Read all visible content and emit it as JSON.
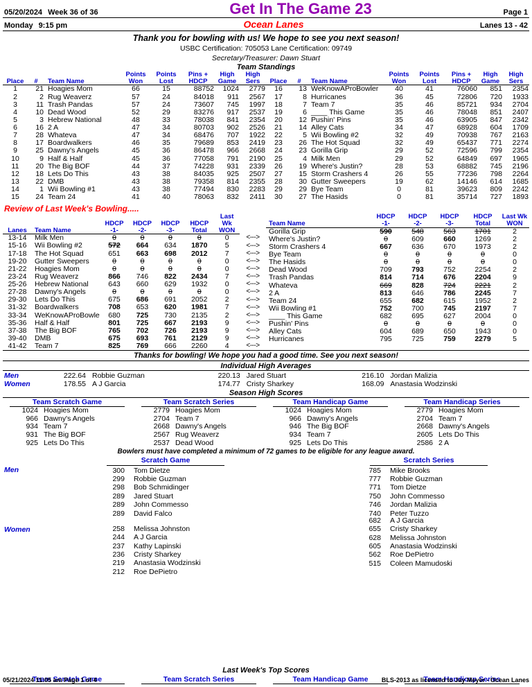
{
  "header": {
    "date": "05/20/2024",
    "week": "Week 36 of 36",
    "title": "Get In The Game 23",
    "page": "Page 1",
    "day": "Monday",
    "time": "9:15 pm",
    "center": "Ocean Lanes",
    "lanes": "Lanes 13 - 42",
    "thanks": "Thank you for bowling with us! We hope to see you next season!",
    "certification": "USBC Certification: 705053   Lane Certification: 09749",
    "secretary": "Secretary/Treasurer: Dawn Stuart"
  },
  "standings": {
    "section_title": "Team Standings",
    "columns": [
      "Place",
      "#",
      "Team Name",
      "Points Won",
      "Points Lost",
      "Pins + HDCP",
      "High Game",
      "High Sers"
    ],
    "headers": {
      "place": "Place",
      "num": "#",
      "team": "Team Name",
      "pts_won_1": "Points",
      "pts_won_2": "Won",
      "pts_lost_1": "Points",
      "pts_lost_2": "Lost",
      "pins_1": "Pins +",
      "pins_2": "HDCP",
      "hg_1": "High",
      "hg_2": "Game",
      "hs_1": "High",
      "hs_2": "Sers"
    },
    "left": [
      {
        "place": "1",
        "num": "21",
        "team": "Hoagies Mom",
        "won": "66",
        "lost": "15",
        "pins": "88752",
        "hg": "1024",
        "hs": "2779"
      },
      {
        "place": "2",
        "num": "2",
        "team": "Rug Weaverz",
        "won": "57",
        "lost": "24",
        "pins": "84018",
        "hg": "911",
        "hs": "2567"
      },
      {
        "place": "3",
        "num": "11",
        "team": "Trash Pandas",
        "won": "57",
        "lost": "24",
        "pins": "73607",
        "hg": "745",
        "hs": "1997"
      },
      {
        "place": "4",
        "num": "10",
        "team": "Dead Wood",
        "won": "52",
        "lost": "29",
        "pins": "83276",
        "hg": "917",
        "hs": "2537"
      },
      {
        "place": "5",
        "num": "3",
        "team": "Hebrew National",
        "won": "48",
        "lost": "33",
        "pins": "78038",
        "hg": "841",
        "hs": "2354"
      },
      {
        "place": "6",
        "num": "16",
        "team": "2 A",
        "won": "47",
        "lost": "34",
        "pins": "80703",
        "hg": "902",
        "hs": "2526"
      },
      {
        "place": "7",
        "num": "28",
        "team": "Whateva",
        "won": "47",
        "lost": "34",
        "pins": "68476",
        "hg": "707",
        "hs": "1922"
      },
      {
        "place": "8",
        "num": "17",
        "team": "Boardwalkers",
        "won": "46",
        "lost": "35",
        "pins": "79689",
        "hg": "853",
        "hs": "2419"
      },
      {
        "place": "9",
        "num": "25",
        "team": "Dawny's Angels",
        "won": "45",
        "lost": "36",
        "pins": "86478",
        "hg": "966",
        "hs": "2668"
      },
      {
        "place": "10",
        "num": "9",
        "team": "Half & Half",
        "won": "45",
        "lost": "36",
        "pins": "77058",
        "hg": "791",
        "hs": "2190"
      },
      {
        "place": "11",
        "num": "20",
        "team": "The Big BOF",
        "won": "44",
        "lost": "37",
        "pins": "74228",
        "hg": "931",
        "hs": "2339"
      },
      {
        "place": "12",
        "num": "18",
        "team": "Lets Do This",
        "won": "43",
        "lost": "38",
        "pins": "84035",
        "hg": "925",
        "hs": "2507"
      },
      {
        "place": "13",
        "num": "22",
        "team": "DMB",
        "won": "43",
        "lost": "38",
        "pins": "79358",
        "hg": "814",
        "hs": "2355"
      },
      {
        "place": "14",
        "num": "1",
        "team": "Wii Bowling #1",
        "won": "43",
        "lost": "38",
        "pins": "77494",
        "hg": "830",
        "hs": "2283"
      },
      {
        "place": "15",
        "num": "24",
        "team": "Team 24",
        "won": "41",
        "lost": "40",
        "pins": "78063",
        "hg": "832",
        "hs": "2411"
      }
    ],
    "right": [
      {
        "place": "16",
        "num": "13",
        "team": "WeKnowAProBowler",
        "won": "40",
        "lost": "41",
        "pins": "76060",
        "hg": "851",
        "hs": "2354"
      },
      {
        "place": "17",
        "num": "8",
        "team": "Hurricanes",
        "won": "36",
        "lost": "45",
        "pins": "72806",
        "hg": "720",
        "hs": "1933"
      },
      {
        "place": "18",
        "num": "7",
        "team": "Team 7",
        "won": "35",
        "lost": "46",
        "pins": "85721",
        "hg": "934",
        "hs": "2704"
      },
      {
        "place": "19",
        "num": "6",
        "team": "____ This Game",
        "won": "35",
        "lost": "46",
        "pins": "78048",
        "hg": "851",
        "hs": "2407"
      },
      {
        "place": "20",
        "num": "12",
        "team": "Pushin' Pins",
        "won": "35",
        "lost": "46",
        "pins": "63905",
        "hg": "847",
        "hs": "2342"
      },
      {
        "place": "21",
        "num": "14",
        "team": "Alley Cats",
        "won": "34",
        "lost": "47",
        "pins": "68928",
        "hg": "604",
        "hs": "1709"
      },
      {
        "place": "22",
        "num": "5",
        "team": "Wii Bowling #2",
        "won": "32",
        "lost": "49",
        "pins": "70938",
        "hg": "767",
        "hs": "2163"
      },
      {
        "place": "23",
        "num": "26",
        "team": "The Hot Squad",
        "won": "32",
        "lost": "49",
        "pins": "65437",
        "hg": "771",
        "hs": "2274"
      },
      {
        "place": "24",
        "num": "23",
        "team": "Gorilla Grip",
        "won": "29",
        "lost": "52",
        "pins": "72596",
        "hg": "799",
        "hs": "2354"
      },
      {
        "place": "25",
        "num": "4",
        "team": "Milk Men",
        "won": "29",
        "lost": "52",
        "pins": "64849",
        "hg": "697",
        "hs": "1965"
      },
      {
        "place": "26",
        "num": "19",
        "team": "Where's Justin?",
        "won": "28",
        "lost": "53",
        "pins": "68882",
        "hg": "745",
        "hs": "2196"
      },
      {
        "place": "27",
        "num": "15",
        "team": "Storm Crashers 4",
        "won": "26",
        "lost": "55",
        "pins": "77236",
        "hg": "798",
        "hs": "2264"
      },
      {
        "place": "28",
        "num": "30",
        "team": "Gutter Sweepers",
        "won": "19",
        "lost": "62",
        "pins": "14146",
        "hg": "614",
        "hs": "1685"
      },
      {
        "place": "29",
        "num": "29",
        "team": "Bye Team",
        "won": "0",
        "lost": "81",
        "pins": "39623",
        "hg": "809",
        "hs": "2242"
      },
      {
        "place": "30",
        "num": "27",
        "team": "The Hasids",
        "won": "0",
        "lost": "81",
        "pins": "35714",
        "hg": "727",
        "hs": "1893"
      }
    ]
  },
  "review": {
    "title": "Review of Last Week's Bowling.....",
    "headers": {
      "lanes": "Lanes",
      "team": "Team Name",
      "h1_1": "HDCP",
      "h1_2": "-1-",
      "h2_1": "HDCP",
      "h2_2": "-2-",
      "h3_1": "HDCP",
      "h3_2": "-3-",
      "tot_1": "HDCP",
      "tot_2": "Total",
      "won_1": "Last Wk",
      "won_2": "WON"
    },
    "arrow": "<--->",
    "left": [
      {
        "lanes": "13-14",
        "team": "Milk Men",
        "g1": "0",
        "g1s": true,
        "g2": "0",
        "g2s": true,
        "g3": "0",
        "g3s": true,
        "tot": "0",
        "tots": true,
        "won": "0"
      },
      {
        "lanes": "15-16",
        "team": "Wii Bowling #2",
        "g1": "572",
        "g1s": true,
        "g1b": true,
        "g2": "664",
        "g2b": true,
        "g3": "634",
        "tot": "1870",
        "totb": true,
        "won": "5"
      },
      {
        "lanes": "17-18",
        "team": "The Hot Squad",
        "g1": "651",
        "g2": "663",
        "g2b": true,
        "g3": "698",
        "g3b": true,
        "tot": "2012",
        "totb": true,
        "won": "7"
      },
      {
        "lanes": "19-20",
        "team": "Gutter Sweepers",
        "g1": "0",
        "g1s": true,
        "g2": "0",
        "g2s": true,
        "g3": "0",
        "g3s": true,
        "tot": "0",
        "tots": true,
        "won": "0"
      },
      {
        "lanes": "21-22",
        "team": "Hoagies Mom",
        "g1": "0",
        "g1s": true,
        "g2": "0",
        "g2s": true,
        "g3": "0",
        "g3s": true,
        "tot": "0",
        "tots": true,
        "won": "0"
      },
      {
        "lanes": "23-24",
        "team": "Rug Weaverz",
        "g1": "866",
        "g1b": true,
        "g2": "746",
        "g3": "822",
        "g3b": true,
        "tot": "2434",
        "totb": true,
        "won": "7"
      },
      {
        "lanes": "25-26",
        "team": "Hebrew National",
        "g1": "643",
        "g2": "660",
        "g3": "629",
        "tot": "1932",
        "won": "0"
      },
      {
        "lanes": "27-28",
        "team": "Dawny's Angels",
        "g1": "0",
        "g1s": true,
        "g2": "0",
        "g2s": true,
        "g3": "0",
        "g3s": true,
        "tot": "0",
        "tots": true,
        "won": "0"
      },
      {
        "lanes": "29-30",
        "team": "Lets Do This",
        "g1": "675",
        "g2": "686",
        "g2b": true,
        "g3": "691",
        "tot": "2052",
        "won": "2"
      },
      {
        "lanes": "31-32",
        "team": "Boardwalkers",
        "g1": "708",
        "g1b": true,
        "g2": "653",
        "g3": "620",
        "g3b": true,
        "tot": "1981",
        "totb": true,
        "won": "7"
      },
      {
        "lanes": "33-34",
        "team": "WeKnowAProBowle",
        "g1": "680",
        "g2": "725",
        "g2b": true,
        "g3": "730",
        "tot": "2135",
        "won": "2"
      },
      {
        "lanes": "35-36",
        "team": "Half & Half",
        "g1": "801",
        "g1b": true,
        "g2": "725",
        "g2b": true,
        "g3": "667",
        "g3b": true,
        "tot": "2193",
        "totb": true,
        "won": "9"
      },
      {
        "lanes": "37-38",
        "team": "The Big BOF",
        "g1": "765",
        "g1b": true,
        "g2": "702",
        "g2b": true,
        "g3": "726",
        "g3b": true,
        "tot": "2193",
        "totb": true,
        "won": "9"
      },
      {
        "lanes": "39-40",
        "team": "DMB",
        "g1": "675",
        "g1b": true,
        "g2": "693",
        "g2b": true,
        "g3": "761",
        "g3b": true,
        "tot": "2129",
        "totb": true,
        "won": "9"
      },
      {
        "lanes": "41-42",
        "team": "Team 7",
        "g1": "825",
        "g1b": true,
        "g2": "769",
        "g2b": true,
        "g3": "666",
        "tot": "2260",
        "won": "4"
      }
    ],
    "right": [
      {
        "team": "Gorilla Grip",
        "g1": "590",
        "g1b": true,
        "g1s": true,
        "g2": "548",
        "g2s": true,
        "g3": "563",
        "g3s": true,
        "tot": "1701",
        "tots": true,
        "won": "2"
      },
      {
        "team": "Where's Justin?",
        "g1": "0",
        "g1s": true,
        "g2": "609",
        "g3": "660",
        "g3b": true,
        "tot": "1269",
        "won": "2"
      },
      {
        "team": "Storm Crashers 4",
        "g1": "667",
        "g1b": true,
        "g2": "636",
        "g3": "670",
        "tot": "1973",
        "won": "2"
      },
      {
        "team": "Bye Team",
        "g1": "0",
        "g1s": true,
        "g2": "0",
        "g2s": true,
        "g3": "0",
        "g3s": true,
        "tot": "0",
        "tots": true,
        "won": "0"
      },
      {
        "team": "The Hasids",
        "g1": "0",
        "g1s": true,
        "g2": "0",
        "g2s": true,
        "g3": "0",
        "g3s": true,
        "tot": "0",
        "tots": true,
        "won": "0"
      },
      {
        "team": "Dead Wood",
        "g1": "709",
        "g2": "793",
        "g2b": true,
        "g3": "752",
        "tot": "2254",
        "won": "2"
      },
      {
        "team": "Trash Pandas",
        "g1": "814",
        "g1b": true,
        "g2": "714",
        "g2b": true,
        "g3": "676",
        "g3b": true,
        "tot": "2204",
        "totb": true,
        "won": "9"
      },
      {
        "team": "Whateva",
        "g1": "669",
        "g1s": true,
        "g2": "828",
        "g2b": true,
        "g3": "724",
        "g3s": true,
        "tot": "2221",
        "tots": true,
        "won": "2"
      },
      {
        "team": "2 A",
        "g1": "813",
        "g1b": true,
        "g2": "646",
        "g3": "786",
        "g3b": true,
        "tot": "2245",
        "totb": true,
        "won": "7"
      },
      {
        "team": "Team 24",
        "g1": "655",
        "g2": "682",
        "g2b": true,
        "g3": "615",
        "tot": "1952",
        "won": "2"
      },
      {
        "team": "Wii Bowling #1",
        "g1": "752",
        "g1b": true,
        "g2": "700",
        "g3": "745",
        "g3b": true,
        "tot": "2197",
        "totb": true,
        "won": "7"
      },
      {
        "team": "____ This Game",
        "g1": "682",
        "g2": "695",
        "g3": "627",
        "tot": "2004",
        "won": "0"
      },
      {
        "team": "Pushin' Pins",
        "g1": "0",
        "g1s": true,
        "g2": "0",
        "g2s": true,
        "g3": "0",
        "g3s": true,
        "tot": "0",
        "tots": true,
        "won": "0"
      },
      {
        "team": "Alley Cats",
        "g1": "604",
        "g2": "689",
        "g3": "650",
        "tot": "1943",
        "won": "0"
      },
      {
        "team": "Hurricanes",
        "g1": "795",
        "g2": "725",
        "g3": "759",
        "g3b": true,
        "tot": "2279",
        "totb": true,
        "won": "5"
      }
    ],
    "closing": "Thanks for bowling! We hope you had a good time. See you next season!"
  },
  "averages": {
    "title": "Individual High Averages",
    "men_label": "Men",
    "women_label": "Women",
    "men": [
      {
        "score": "222.64",
        "name": "Robbie Guzman"
      },
      {
        "score": "220.13",
        "name": "Jared Stuart"
      },
      {
        "score": "216.10",
        "name": "Jordan Malizia"
      }
    ],
    "women": [
      {
        "score": "178.55",
        "name": "A J Garcia"
      },
      {
        "score": "174.77",
        "name": "Cristy Sharkey"
      },
      {
        "score": "168.09",
        "name": "Anastasia Wodzinski"
      }
    ]
  },
  "season_high": {
    "title": "Season High Scores",
    "eligibility": "Bowlers must have completed a minimum of 72 games to be eligible for any league award.",
    "blocks": [
      {
        "title": "Team Scratch Game",
        "rows": [
          {
            "score": "1024",
            "name": "Hoagies Mom"
          },
          {
            "score": "966",
            "name": "Dawny's Angels"
          },
          {
            "score": "934",
            "name": "Team 7"
          },
          {
            "score": "931",
            "name": "The Big BOF"
          },
          {
            "score": "925",
            "name": "Lets Do This"
          }
        ]
      },
      {
        "title": "Team Scratch Series",
        "rows": [
          {
            "score": "2779",
            "name": "Hoagies Mom"
          },
          {
            "score": "2704",
            "name": "Team 7"
          },
          {
            "score": "2668",
            "name": "Dawny's Angels"
          },
          {
            "score": "2567",
            "name": "Rug Weaverz"
          },
          {
            "score": "2537",
            "name": "Dead Wood"
          }
        ]
      },
      {
        "title": "Team Handicap Game",
        "rows": [
          {
            "score": "1024",
            "name": "Hoagies Mom"
          },
          {
            "score": "966",
            "name": "Dawny's Angels"
          },
          {
            "score": "946",
            "name": "The Big BOF"
          },
          {
            "score": "934",
            "name": "Team 7"
          },
          {
            "score": "925",
            "name": "Lets Do This"
          }
        ]
      },
      {
        "title": "Team Handicap Series",
        "rows": [
          {
            "score": "2779",
            "name": "Hoagies Mom"
          },
          {
            "score": "2704",
            "name": "Team 7"
          },
          {
            "score": "2668",
            "name": "Dawny's Angels"
          },
          {
            "score": "2605",
            "name": "Lets Do This"
          },
          {
            "score": "2586",
            "name": "2 A"
          }
        ]
      }
    ]
  },
  "individual": {
    "scratch_game_title": "Scratch Game",
    "scratch_series_title": "Scratch Series",
    "men_label": "Men",
    "women_label": "Women",
    "men_game": [
      {
        "score": "300",
        "name": "Tom Dietze"
      },
      {
        "score": "299",
        "name": "Robbie Guzman"
      },
      {
        "score": "298",
        "name": "Bob Schmidinger"
      },
      {
        "score": "289",
        "name": "Jared Stuart"
      },
      {
        "score": "289",
        "name": "John Commesso"
      },
      {
        "score": "289",
        "name": "David Falco"
      }
    ],
    "men_series": [
      {
        "score": "785",
        "name": "Mike Brooks"
      },
      {
        "score": "777",
        "name": "Robbie Guzman"
      },
      {
        "score": "771",
        "name": "Tom Dietze"
      },
      {
        "score": "750",
        "name": "John Commesso"
      },
      {
        "score": "746",
        "name": "Jordan Malizia"
      },
      {
        "score": "740",
        "name": "Peter Tuzzo"
      }
    ],
    "women_game": [
      {
        "score": "258",
        "name": "Melissa Johnston"
      },
      {
        "score": "244",
        "name": "A J Garcia"
      },
      {
        "score": "237",
        "name": "Kathy Lapinski"
      },
      {
        "score": "236",
        "name": "Cristy Sharkey"
      },
      {
        "score": "219",
        "name": "Anastasia Wodzinski"
      },
      {
        "score": "212",
        "name": "Roe DePietro"
      }
    ],
    "women_series": [
      {
        "score": "682",
        "name": "A J Garcia"
      },
      {
        "score": "655",
        "name": "Cristy Sharkey"
      },
      {
        "score": "628",
        "name": "Melissa Johnston"
      },
      {
        "score": "605",
        "name": "Anastasia Wodzinski"
      },
      {
        "score": "562",
        "name": "Roe DePietro"
      },
      {
        "score": "515",
        "name": "Coleen Mamudoski"
      }
    ]
  },
  "last_week": {
    "title": "Last Week's Top Scores",
    "blocks": [
      "Team Scratch Game",
      "Team Scratch Series",
      "Team Handicap Game",
      "Team Handicap Series"
    ]
  },
  "footer": {
    "stamp": "05/21/2024  11:05 am  Page 1 of 4",
    "license": "BLS-2013 as licensed to Jay Meyer - Ocean Lanes"
  },
  "colors": {
    "title": "#9400b0",
    "accent_red": "#ff0000",
    "header_blue": "#0000cc"
  }
}
